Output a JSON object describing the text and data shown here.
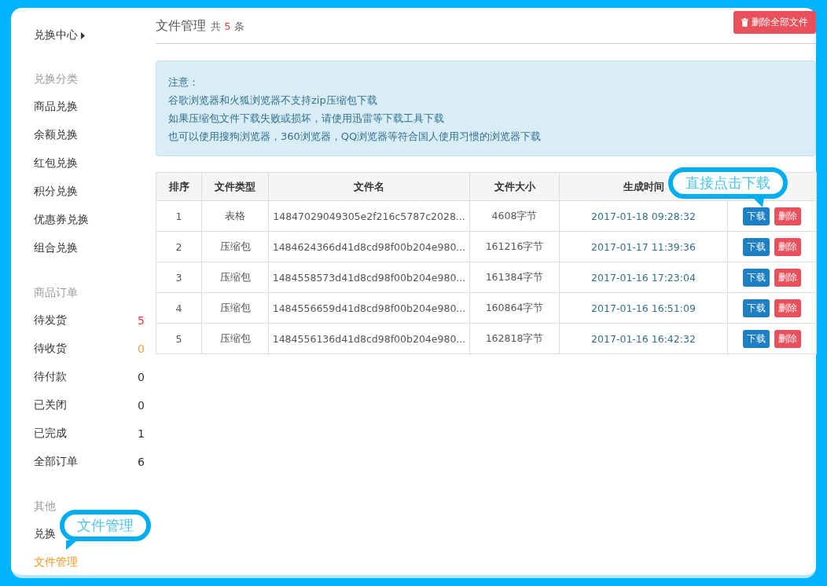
{
  "sidebar": {
    "top_link": "兑换中心",
    "groups": [
      {
        "title": "兑换分类",
        "items": [
          {
            "label": "商品兑换",
            "selected": false
          },
          {
            "label": "余额兑换",
            "selected": false
          },
          {
            "label": "红包兑换",
            "selected": false
          },
          {
            "label": "积分兑换",
            "selected": false
          },
          {
            "label": "优惠券兑换",
            "selected": false
          },
          {
            "label": "组合兑换",
            "selected": false
          }
        ]
      },
      {
        "title": "商品订单",
        "items": [
          {
            "label": "待发货",
            "count": "5",
            "color": "#e4393c",
            "selected": false
          },
          {
            "label": "待收货",
            "count": "0",
            "color": "#f0a050",
            "selected": false
          },
          {
            "label": "待付款",
            "count": "0",
            "color": "#333333",
            "selected": false
          },
          {
            "label": "已关闭",
            "count": "0",
            "color": "#333333",
            "selected": false
          },
          {
            "label": "已完成",
            "count": "1",
            "color": "#333333",
            "selected": false
          },
          {
            "label": "全部订单",
            "count": "6",
            "color": "#333333",
            "selected": false
          }
        ]
      },
      {
        "title": "其他",
        "items": [
          {
            "label": "兑换",
            "selected": false
          },
          {
            "label": "文件管理",
            "selected": true
          }
        ]
      }
    ],
    "callout": "文件管理"
  },
  "main": {
    "title": "文件管理",
    "count_prefix": "共",
    "count": "5",
    "count_suffix": "条",
    "delete_all_button": "删除全部文件",
    "notice": [
      "注意：",
      "谷歌浏览器和火狐浏览器不支持zip压缩包下载",
      "如果压缩包文件下载失败或损坏，请使用迅雷等下载工具下载",
      "也可以使用搜狗浏览器，360浏览器，QQ浏览器等符合国人使用习惯的浏览器下载"
    ],
    "table": {
      "columns": [
        "排序",
        "文件类型",
        "文件名",
        "文件大小",
        "生成时间"
      ],
      "rows": [
        {
          "index": "1",
          "type": "表格",
          "name": "14847029049305e2f216c5787c2028...",
          "size": "4608字节",
          "time": "2017-01-18 09:28:32",
          "actions": [
            "下载",
            "删除"
          ]
        },
        {
          "index": "2",
          "type": "压缩包",
          "name": "1484624366d41d8cd98f00b204e980...",
          "size": "161216字节",
          "time": "2017-01-17 11:39:36",
          "actions": [
            "下载",
            "删除"
          ]
        },
        {
          "index": "3",
          "type": "压缩包",
          "name": "1484558573d41d8cd98f00b204e980...",
          "size": "161384字节",
          "time": "2017-01-16 17:23:04",
          "actions": [
            "下载",
            "删除"
          ]
        },
        {
          "index": "4",
          "type": "压缩包",
          "name": "1484556659d41d8cd98f00b204e980...",
          "size": "160864字节",
          "time": "2017-01-16 16:51:09",
          "actions": [
            "下载",
            "删除"
          ]
        },
        {
          "index": "5",
          "type": "压缩包",
          "name": "1484556136d41d8cd98f00b204e980...",
          "size": "162818字节",
          "time": "2017-01-16 16:42:32",
          "actions": [
            "下载",
            "删除"
          ]
        }
      ],
      "callout": "直接点击下载"
    }
  }
}
